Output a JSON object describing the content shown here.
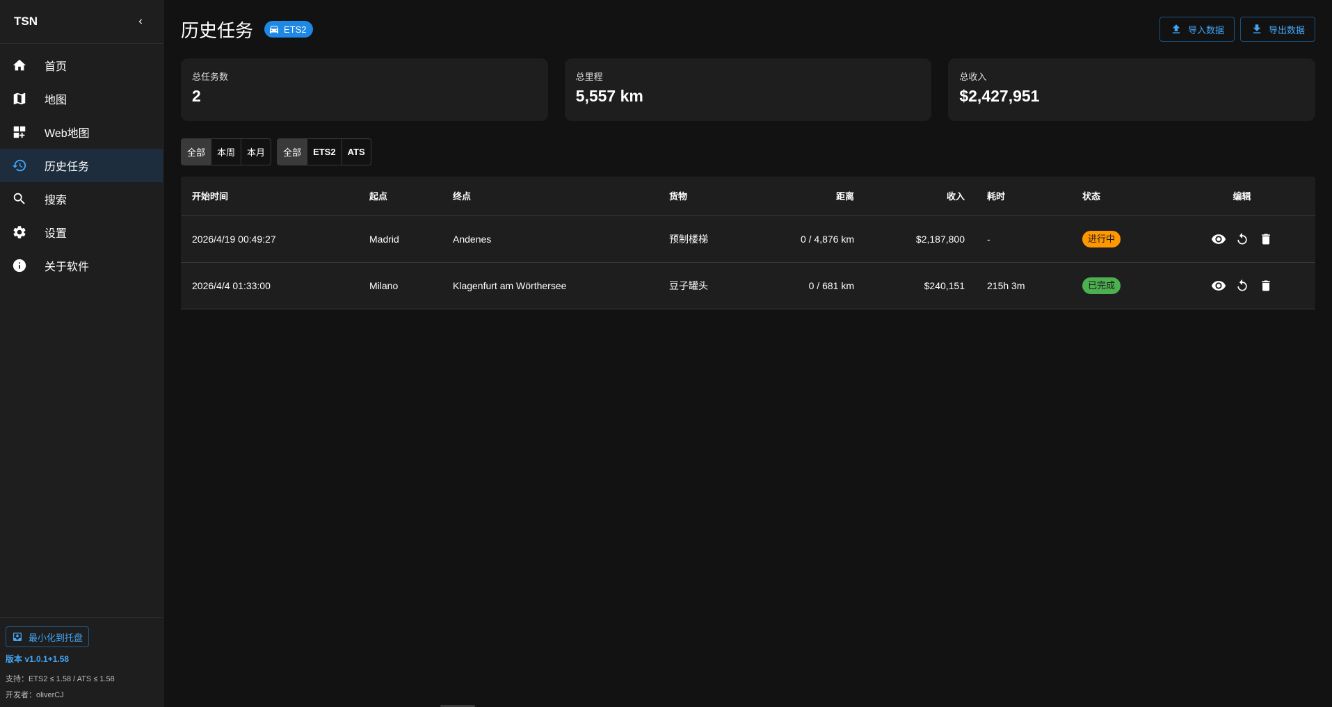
{
  "sidebar": {
    "brand": "TSN",
    "items": [
      {
        "label": "首页",
        "icon": "home-icon"
      },
      {
        "label": "地图",
        "icon": "map-icon"
      },
      {
        "label": "Web地图",
        "icon": "dashboard-add-icon"
      },
      {
        "label": "历史任务",
        "icon": "history-icon",
        "active": true
      },
      {
        "label": "搜索",
        "icon": "search-icon"
      },
      {
        "label": "设置",
        "icon": "gear-icon"
      },
      {
        "label": "关于软件",
        "icon": "info-icon"
      }
    ],
    "footer": {
      "tray_label": "最小化到托盘",
      "version": "版本 v1.0.1+1.58",
      "support": "支持：ETS2 ≤ 1.58 / ATS ≤ 1.58",
      "developer": "开发者：oliverCJ"
    }
  },
  "header": {
    "title": "历史任务",
    "game_chip": "ETS2",
    "import_label": "导入数据",
    "export_label": "导出数据"
  },
  "stats": [
    {
      "label": "总任务数",
      "value": "2"
    },
    {
      "label": "总里程",
      "value": "5,557 km"
    },
    {
      "label": "总收入",
      "value": "$2,427,951"
    }
  ],
  "filters": {
    "time": [
      "全部",
      "本周",
      "本月"
    ],
    "time_selected": 0,
    "game": [
      "全部",
      "ETS2",
      "ATS"
    ],
    "game_selected": 0
  },
  "table": {
    "columns": [
      "开始时间",
      "起点",
      "终点",
      "货物",
      "距离",
      "收入",
      "耗时",
      "状态",
      "编辑"
    ],
    "rows": [
      {
        "start": "2026/4/19 00:49:27",
        "origin": "Madrid",
        "destination": "Andenes",
        "cargo": "预制楼梯",
        "distance": "0 / 4,876 km",
        "income": "$2,187,800",
        "duration": "-",
        "status": "进行中",
        "status_type": "progress"
      },
      {
        "start": "2026/4/4 01:33:00",
        "origin": "Milano",
        "destination": "Klagenfurt am Wörthersee",
        "cargo": "豆子罐头",
        "distance": "0 / 681 km",
        "income": "$240,151",
        "duration": "215h 3m",
        "status": "已完成",
        "status_type": "done"
      }
    ]
  },
  "colors": {
    "accent": "#42a5f5",
    "chip": "#1e88e5",
    "status_progress": "#ff9800",
    "status_done": "#4caf50",
    "active_nav": "#1d2d3d"
  }
}
